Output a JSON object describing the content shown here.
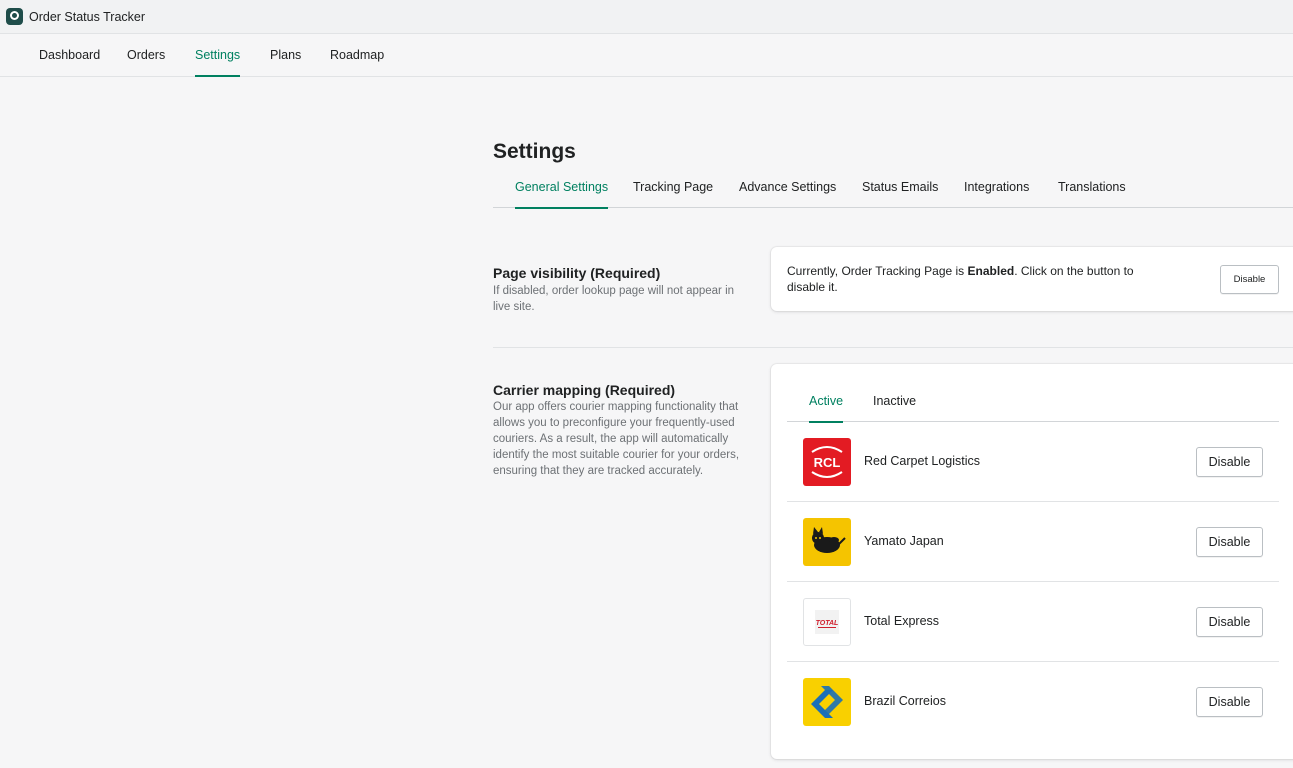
{
  "app": {
    "title": "Order Status Tracker"
  },
  "topnav": {
    "items": [
      {
        "label": "Dashboard"
      },
      {
        "label": "Orders"
      },
      {
        "label": "Settings",
        "active": true
      },
      {
        "label": "Plans"
      },
      {
        "label": "Roadmap"
      }
    ]
  },
  "page": {
    "title": "Settings"
  },
  "settings_tabs": [
    {
      "label": "General Settings",
      "active": true
    },
    {
      "label": "Tracking Page"
    },
    {
      "label": "Advance Settings"
    },
    {
      "label": "Status Emails"
    },
    {
      "label": "Integrations"
    },
    {
      "label": "Translations"
    }
  ],
  "visibility": {
    "heading": "Page visibility (Required)",
    "description": "If disabled, order lookup page will not appear in live site.",
    "status_prefix": "Currently, Order Tracking Page is ",
    "status_value": "Enabled",
    "status_suffix": ". Click on the button to disable it.",
    "button_label": "Disable"
  },
  "carrier_mapping": {
    "heading": "Carrier mapping (Required)",
    "description": "Our app offers courier mapping functionality that allows you to preconfigure your frequently-used couriers. As a result, the app will automatically identify the most suitable courier for your orders, ensuring that they are tracked accurately.",
    "tabs": [
      {
        "label": "Active",
        "active": true
      },
      {
        "label": "Inactive"
      }
    ],
    "carriers": [
      {
        "name": "Red Carpet Logistics",
        "logo_text": "RCL",
        "button_label": "Disable",
        "logo_color": "#e31b23"
      },
      {
        "name": "Yamato Japan",
        "logo_text": "",
        "button_label": "Disable",
        "logo_color": "#f5c400"
      },
      {
        "name": "Total Express",
        "logo_text": "TOTAL",
        "button_label": "Disable",
        "logo_color": "#ffffff"
      },
      {
        "name": "Brazil Correios",
        "logo_text": "",
        "button_label": "Disable",
        "logo_color": "#f9d000"
      }
    ]
  },
  "colors": {
    "accent": "#008060",
    "text": "#202223",
    "subdued": "#6d7175",
    "background": "#f6f6f7"
  }
}
